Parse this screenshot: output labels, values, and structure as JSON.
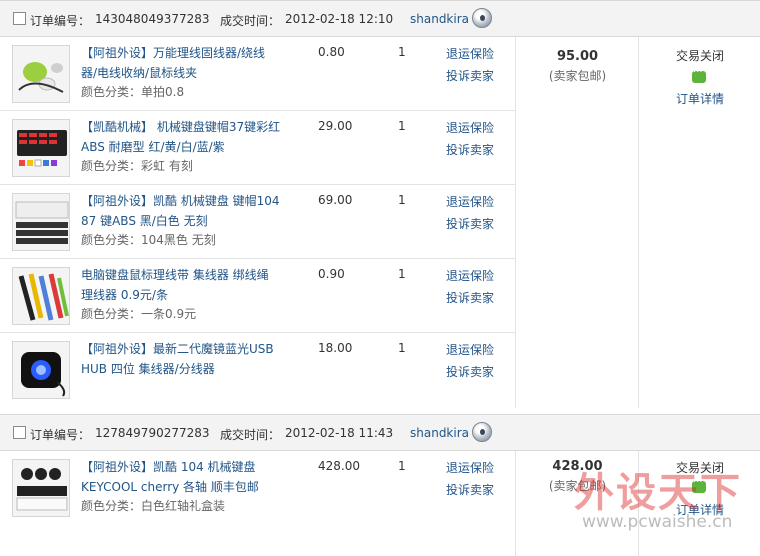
{
  "orders": [
    {
      "label": "订单编号：",
      "number": "143048049377283",
      "time_label": "成交时间：",
      "time": "2012-02-18 12:10",
      "seller": "shandkira",
      "total": "95.00",
      "shipping": "(卖家包邮)",
      "status": "交易关闭",
      "detail_link": "订单详情",
      "items": [
        {
          "title": "【阿祖外设】万能理线固线器/绕线器/电线收纳/鼠标线夹",
          "variant": "颜色分类：单拍0.8",
          "price": "0.80",
          "qty": "1",
          "op1": "退运保险",
          "op2": "投诉卖家"
        },
        {
          "title": "【凯酷机械】 机械键盘键帽37键彩红 ABS 耐磨型 红/黄/白/蓝/紫",
          "variant": "颜色分类：彩虹 有刻",
          "price": "29.00",
          "qty": "1",
          "op1": "退运保险",
          "op2": "投诉卖家"
        },
        {
          "title": "【阿祖外设】凯酷 机械键盘 键帽104 87 键ABS 黑/白色 无刻",
          "variant": "颜色分类：104黑色 无刻",
          "price": "69.00",
          "qty": "1",
          "op1": "退运保险",
          "op2": "投诉卖家"
        },
        {
          "title": "电脑键盘鼠标理线带 集线器 绑线绳 理线器 0.9元/条",
          "variant": "颜色分类：一条0.9元",
          "price": "0.90",
          "qty": "1",
          "op1": "退运保险",
          "op2": "投诉卖家"
        },
        {
          "title": "【阿祖外设】最新二代魔镜蓝光USB HUB 四位 集线器/分线器",
          "variant": "",
          "price": "18.00",
          "qty": "1",
          "op1": "退运保险",
          "op2": "投诉卖家"
        }
      ]
    },
    {
      "label": "订单编号：",
      "number": "127849790277283",
      "time_label": "成交时间：",
      "time": "2012-02-18 11:43",
      "seller": "shandkira",
      "total": "428.00",
      "shipping": "(卖家包邮)",
      "status": "交易关闭",
      "detail_link": "订单详情",
      "items": [
        {
          "title": "【阿祖外设】凯酷 104 机械键盘 KEYCOOL cherry 各轴 顺丰包邮",
          "variant": "颜色分类：白色红轴礼盒装",
          "price": "428.00",
          "qty": "1",
          "op1": "退运保险",
          "op2": "投诉卖家"
        }
      ]
    }
  ],
  "watermark": {
    "text": "外设天下",
    "url": "www.pcwaishe.cn"
  },
  "icons": {
    "chat": "wangwang-chat-icon",
    "status": "green-chat-icon"
  }
}
